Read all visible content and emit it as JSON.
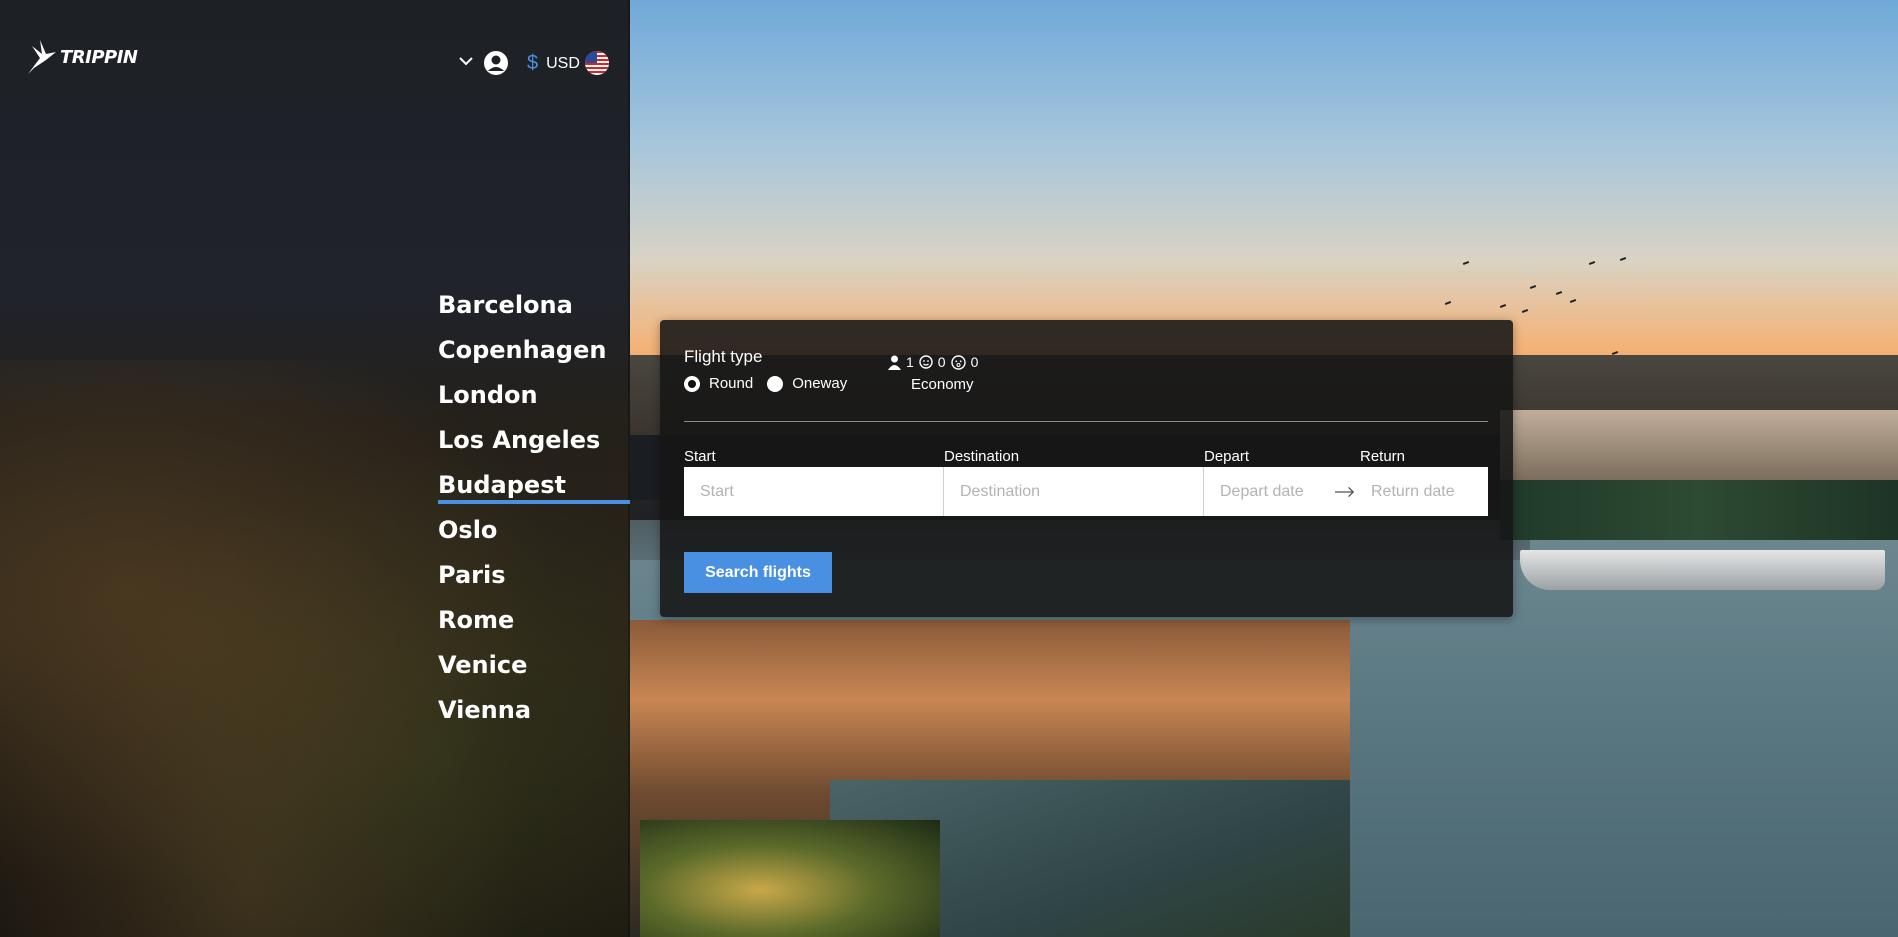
{
  "header": {
    "logo_text": "TRIPPIN",
    "currency_symbol": "$",
    "currency_code": "USD",
    "icons": [
      "bird-logo-icon",
      "chevron-down-icon",
      "user-icon",
      "us-flag-icon"
    ]
  },
  "cities": [
    {
      "label": "Barcelona",
      "active": false
    },
    {
      "label": "Copenhagen",
      "active": false
    },
    {
      "label": "London",
      "active": false
    },
    {
      "label": "Los Angeles",
      "active": false
    },
    {
      "label": "Budapest",
      "active": true
    },
    {
      "label": "Oslo",
      "active": false
    },
    {
      "label": "Paris",
      "active": false
    },
    {
      "label": "Rome",
      "active": false
    },
    {
      "label": "Venice",
      "active": false
    },
    {
      "label": "Vienna",
      "active": false
    }
  ],
  "search": {
    "flight_type_label": "Flight type",
    "options": [
      {
        "label": "Round",
        "selected": true
      },
      {
        "label": "Oneway",
        "selected": false
      }
    ],
    "passengers": {
      "adults": "1",
      "children": "0",
      "infants": "0"
    },
    "cabin_class": "Economy",
    "fields": {
      "start": {
        "label": "Start",
        "placeholder": "Start"
      },
      "destination": {
        "label": "Destination",
        "placeholder": "Destination"
      },
      "depart": {
        "label": "Depart",
        "placeholder": "Depart date"
      },
      "return": {
        "label": "Return",
        "placeholder": "Return date"
      }
    },
    "button_label": "Search flights"
  },
  "colors": {
    "accent": "#4a90e2",
    "card_bg": "#161616",
    "panel_bg": "#1d2126"
  }
}
